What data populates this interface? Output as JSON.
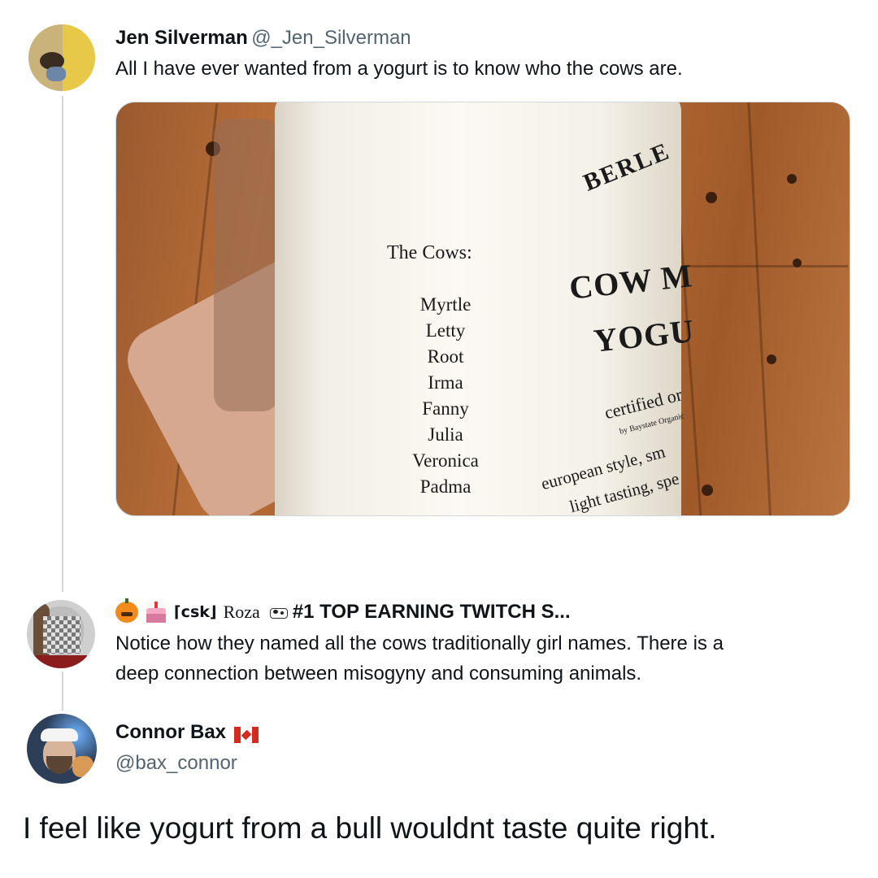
{
  "tweet1": {
    "name": "Jen Silverman",
    "handle": "@_Jen_Silverman",
    "text": "All I have ever wanted from a yogurt is to know who the cows are.",
    "photo": {
      "brand": "BERLE",
      "heading": "The Cows:",
      "cows": [
        "Myrtle",
        "Letty",
        "Root",
        "Irma",
        "Fanny",
        "Julia",
        "Veronica",
        "Padma"
      ],
      "product_line1": "COW M",
      "product_line2": "YOGU",
      "certified": "certified or",
      "certifier": "by Baystate Organic",
      "desc1": "european style, sm",
      "desc2": "light tasting, spe"
    }
  },
  "tweet2": {
    "name_prefix_icons": [
      "pumpkin-icon",
      "cake-icon"
    ],
    "name_part1": "⌈csk⌋",
    "name_part2": "Roza",
    "name_part3": "#1 TOP EARNING TWITCH S...",
    "text_line1": "Notice how they named all the cows traditionally girl names. There is a",
    "text_line2": "deep connection between misogyny and consuming animals."
  },
  "tweet3": {
    "name": "Connor Bax",
    "handle": "@bax_connor",
    "text": "I feel like yogurt from a bull wouldnt taste quite right."
  },
  "colors": {
    "text": "#0f1419",
    "secondary": "#536471",
    "thread_line": "#cfd9de"
  }
}
